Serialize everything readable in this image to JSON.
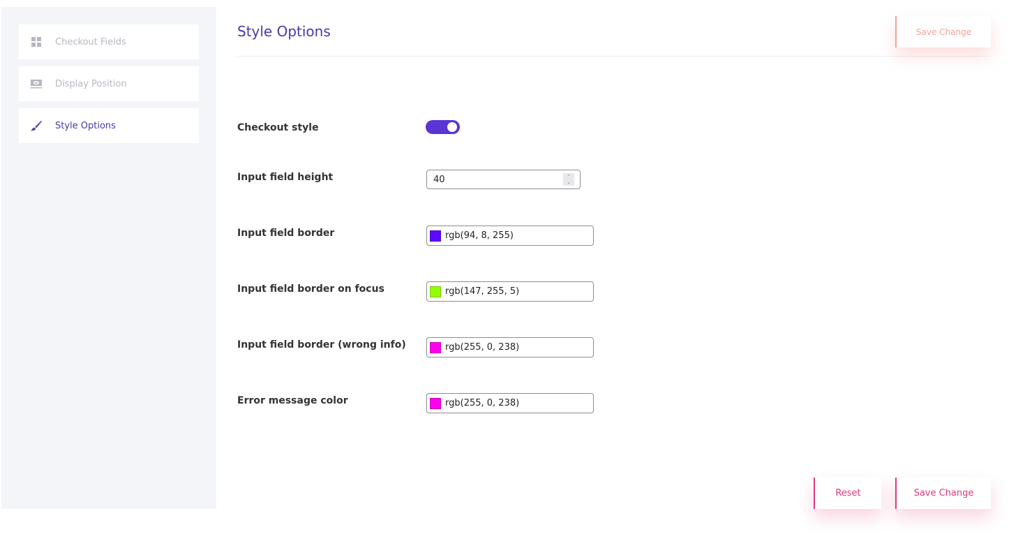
{
  "sidebar": {
    "items": [
      {
        "label": "Checkout Fields",
        "icon": "grid-icon",
        "active": false
      },
      {
        "label": "Display Position",
        "icon": "display-icon",
        "active": false
      },
      {
        "label": "Style Options",
        "icon": "brush-icon",
        "active": true
      }
    ]
  },
  "header": {
    "title": "Style Options",
    "save_label": "Save Change"
  },
  "form": {
    "checkout_style": {
      "label": "Checkout style",
      "enabled": true
    },
    "input_height": {
      "label": "Input field height",
      "value": "40"
    },
    "border": {
      "label": "Input field border",
      "value": "rgb(94, 8, 255)",
      "color": "#5e08ff"
    },
    "border_focus": {
      "label": "Input field border on focus",
      "value": "rgb(147, 255, 5)",
      "color": "#93ff05"
    },
    "border_wrong": {
      "label": "Input field border (wrong info)",
      "value": "rgb(255, 0, 238)",
      "color": "#ff00ee"
    },
    "error_color": {
      "label": "Error message color",
      "value": "rgb(255, 0, 238)",
      "color": "#ff00ee"
    }
  },
  "footer": {
    "reset_label": "Reset",
    "save_label": "Save Change"
  },
  "colors": {
    "accent": "#4a3aa8",
    "toggle": "#5a35d3",
    "button_pink": "#de3a7c",
    "button_salmon": "#f4a097"
  }
}
